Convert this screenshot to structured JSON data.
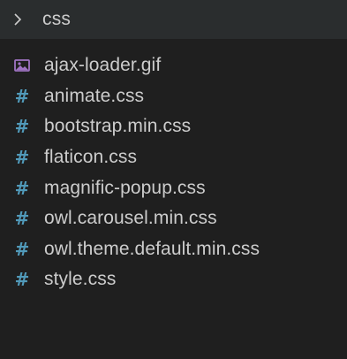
{
  "explorer": {
    "folder": {
      "name": "css",
      "expanded": false,
      "icon": "chevron-right-icon"
    },
    "colors": {
      "background": "#1f1f1f",
      "folder_row_background": "#2a2d2e",
      "text": "#cccccc",
      "css_hash": "#519aba",
      "image_icon": "#a074c4"
    },
    "files": [
      {
        "name": "ajax-loader.gif",
        "icon": "image-file-icon",
        "glyph": ""
      },
      {
        "name": "animate.css",
        "icon": "css-hash-icon",
        "glyph": "#"
      },
      {
        "name": "bootstrap.min.css",
        "icon": "css-hash-icon",
        "glyph": "#"
      },
      {
        "name": "flaticon.css",
        "icon": "css-hash-icon",
        "glyph": "#"
      },
      {
        "name": "magnific-popup.css",
        "icon": "css-hash-icon",
        "glyph": "#"
      },
      {
        "name": "owl.carousel.min.css",
        "icon": "css-hash-icon",
        "glyph": "#"
      },
      {
        "name": "owl.theme.default.min.css",
        "icon": "css-hash-icon",
        "glyph": "#"
      },
      {
        "name": "style.css",
        "icon": "css-hash-icon",
        "glyph": "#"
      }
    ]
  }
}
